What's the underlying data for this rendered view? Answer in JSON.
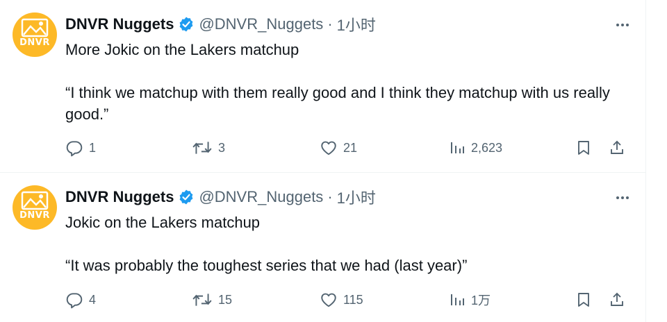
{
  "tweets": [
    {
      "author": {
        "avatar_text": "DNVR",
        "display_name": "DNVR Nuggets",
        "handle": "@DNVR_Nuggets",
        "time": "1小时"
      },
      "text_lines": [
        "More Jokic on the Lakers matchup",
        "“I think we matchup with them really good and I think they matchup with us really good.”"
      ],
      "stats": {
        "replies": "1",
        "retweets": "3",
        "likes": "21",
        "views": "2,623"
      }
    },
    {
      "author": {
        "avatar_text": "DNVR",
        "display_name": "DNVR Nuggets",
        "handle": "@DNVR_Nuggets",
        "time": "1小时"
      },
      "text_lines": [
        "Jokic on the Lakers matchup",
        "“It was probably the toughest series that we had (last year)”"
      ],
      "stats": {
        "replies": "4",
        "retweets": "15",
        "likes": "115",
        "views": "1万"
      }
    }
  ],
  "separator": "·",
  "icons": {
    "more": "more-horizontal-icon",
    "verified": "verified-badge-icon",
    "reply": "reply-icon",
    "retweet": "retweet-icon",
    "like": "heart-icon",
    "views": "views-icon",
    "bookmark": "bookmark-icon",
    "share": "share-icon"
  },
  "colors": {
    "avatar_bg": "#fdb927",
    "verified": "#1d9bf0",
    "secondary_text": "#536471",
    "primary_text": "#0f1419",
    "border": "#eff3f4"
  }
}
